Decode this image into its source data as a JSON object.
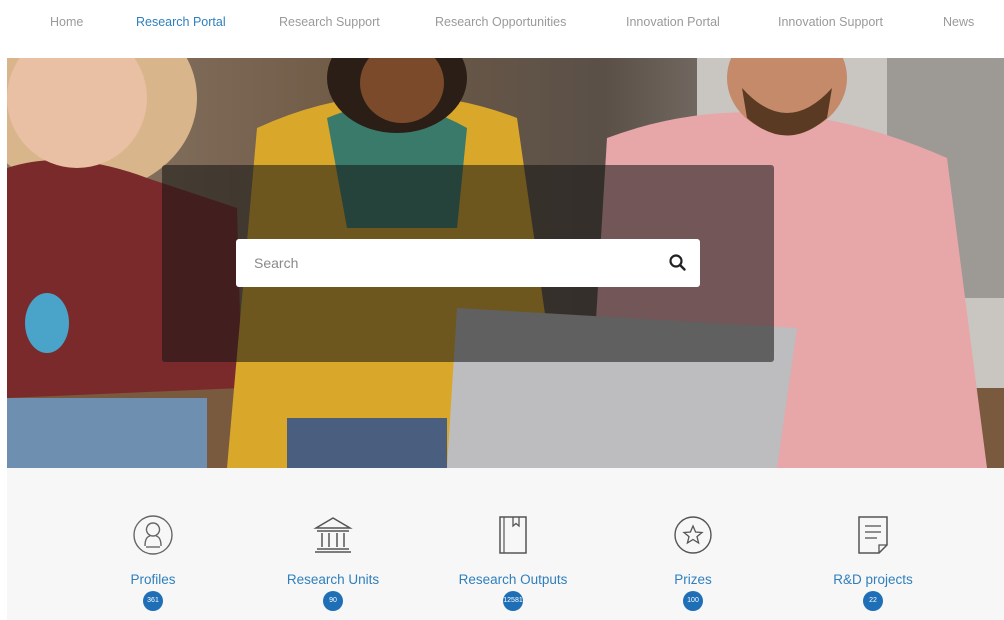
{
  "nav": {
    "items": [
      {
        "label": "Home",
        "active": false
      },
      {
        "label": "Research Portal",
        "active": true
      },
      {
        "label": "Research Support",
        "active": false
      },
      {
        "label": "Research Opportunities",
        "active": false
      },
      {
        "label": "Innovation Portal",
        "active": false
      },
      {
        "label": "Innovation Support",
        "active": false
      },
      {
        "label": "News",
        "active": false
      }
    ],
    "active_color": "#2f7fbd",
    "inactive_color": "#9a9a9a"
  },
  "search": {
    "placeholder": "Search",
    "value": "",
    "icon": "search-icon"
  },
  "stats": {
    "accent_color": "#2f7fbd",
    "badge_color": "#1f6fb7",
    "items": [
      {
        "label": "Profiles",
        "count": "361",
        "icon": "profile-icon"
      },
      {
        "label": "Research Units",
        "count": "90",
        "icon": "institution-icon"
      },
      {
        "label": "Research Outputs",
        "count": "12581",
        "icon": "book-icon"
      },
      {
        "label": "Prizes",
        "count": "100",
        "icon": "star-icon"
      },
      {
        "label": "R&D projects",
        "count": "22",
        "icon": "document-icon"
      }
    ]
  }
}
